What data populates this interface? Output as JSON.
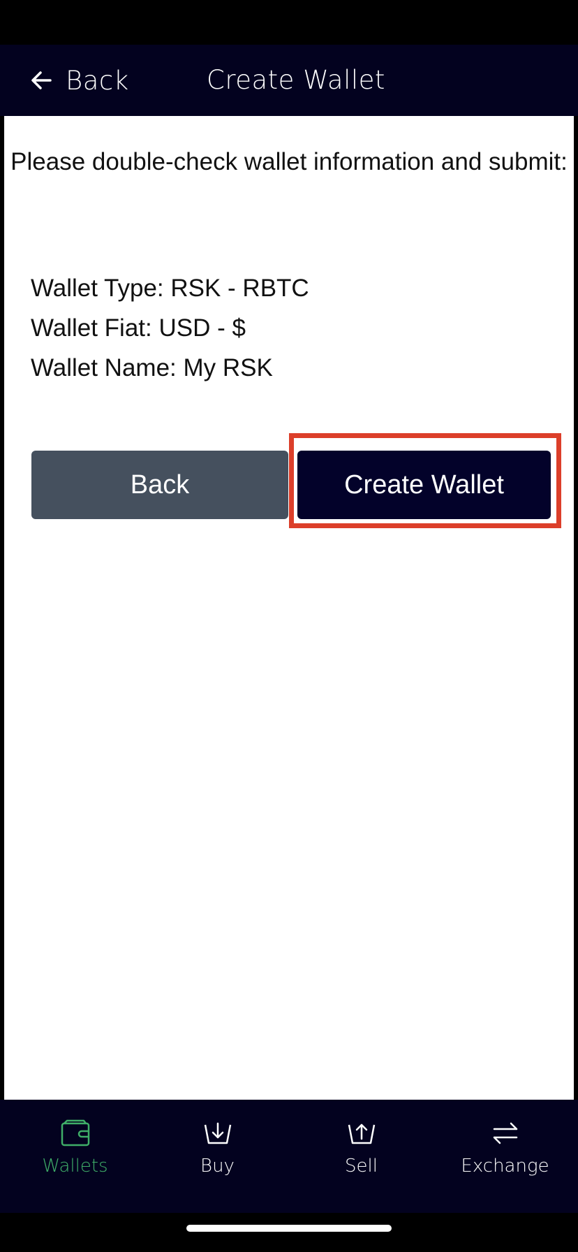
{
  "header": {
    "back_label": "Back",
    "title": "Create Wallet",
    "back_icon": "arrow-left-icon"
  },
  "main": {
    "instruction": "Please double-check wallet information and submit:",
    "details": [
      "Wallet Type: RSK - RBTC",
      "Wallet Fiat: USD - $",
      "Wallet Name: My RSK"
    ],
    "back_button": "Back",
    "create_button": "Create Wallet"
  },
  "tabs": [
    {
      "label": "Wallets",
      "icon": "wallet-icon",
      "active": true
    },
    {
      "label": "Buy",
      "icon": "buy-icon",
      "active": false
    },
    {
      "label": "Sell",
      "icon": "sell-icon",
      "active": false
    },
    {
      "label": "Exchange",
      "icon": "exchange-icon",
      "active": false
    }
  ],
  "colors": {
    "header_bg": "#03021f",
    "primary_button": "#03022a",
    "secondary_button": "#45505e",
    "active_tab": "#3fae68",
    "highlight": "#dc3f2a"
  }
}
